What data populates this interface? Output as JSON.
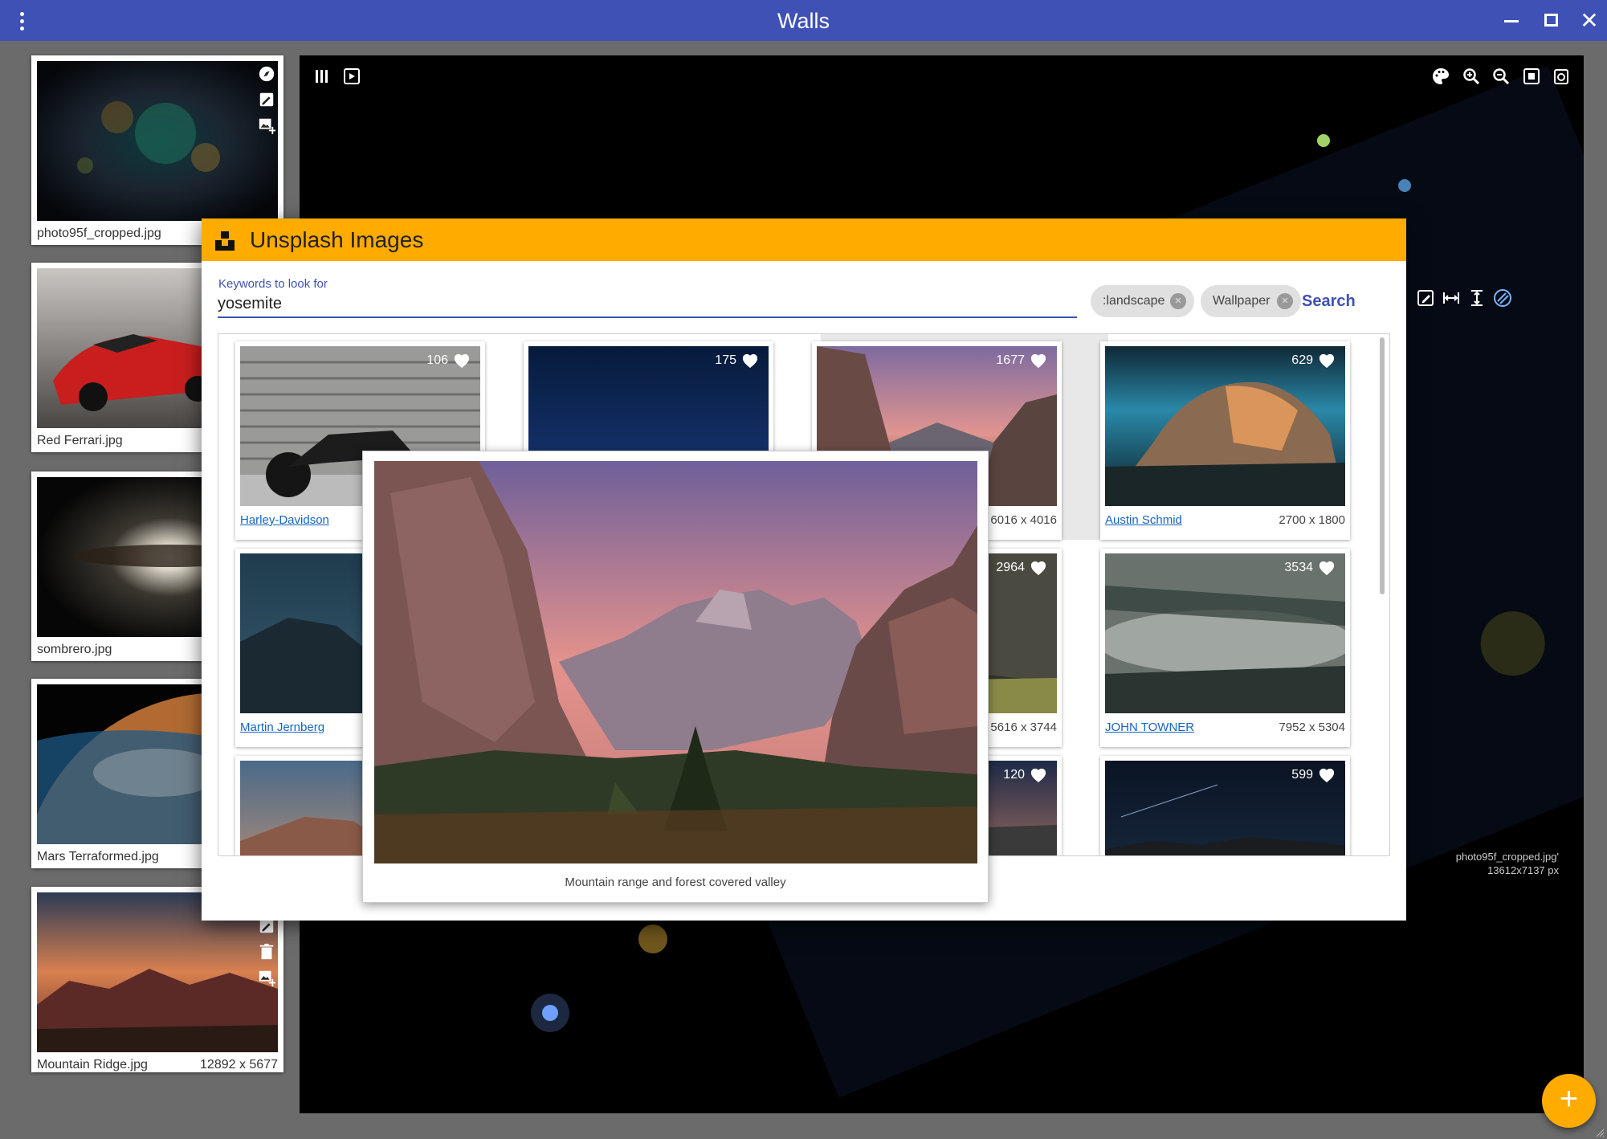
{
  "window": {
    "title": "Walls"
  },
  "gallery": [
    {
      "name": "photo95f_cropped.jpg",
      "size": ""
    },
    {
      "name": "Red Ferrari.jpg",
      "size": ""
    },
    {
      "name": "sombrero.jpg",
      "size": ""
    },
    {
      "name": "Mars Terraformed.jpg",
      "size": ""
    },
    {
      "name": "Mountain Ridge.jpg",
      "size": "12892 x 5677"
    }
  ],
  "viewer": {
    "overlay_filename": "photo95f_cropped.jpg'",
    "overlay_size": "13612x7137 px"
  },
  "dialog": {
    "title": "Unsplash Images",
    "keyword_label": "Keywords to look for",
    "keyword_value": "yosemite",
    "chips": [
      ":landscape",
      "Wallpaper"
    ],
    "search_label": "Search",
    "results": [
      {
        "likes": "106",
        "author": "Harley-Davidson",
        "dims": ""
      },
      {
        "likes": "175",
        "author": "",
        "dims": ""
      },
      {
        "likes": "1677",
        "author": "",
        "dims": "6016 x 4016"
      },
      {
        "likes": "629",
        "author": "Austin Schmid",
        "dims": "2700 x 1800"
      },
      {
        "likes": "",
        "author": "Martin Jernberg",
        "dims": ""
      },
      {
        "likes": "",
        "author": "",
        "dims": ""
      },
      {
        "likes": "2964",
        "author": "",
        "dims": "5616 x 3744"
      },
      {
        "likes": "3534",
        "author": "JOHN TOWNER",
        "dims": "7952 x 5304"
      },
      {
        "likes": "",
        "author": "",
        "dims": ""
      },
      {
        "likes": "",
        "author": "",
        "dims": ""
      },
      {
        "likes": "120",
        "author": "",
        "dims": ""
      },
      {
        "likes": "599",
        "author": "",
        "dims": ""
      }
    ],
    "preview_caption": "Mountain range and forest covered valley"
  },
  "fab": {
    "label": "+"
  },
  "colors": {
    "titlebar": "#3f51b5",
    "accent": "#ffab00",
    "link": "#1565c0"
  },
  "icons": [
    "menu-dots-icon",
    "minimize-icon",
    "maximize-icon",
    "close-icon",
    "columns-icon",
    "slideshow-icon",
    "palette-icon",
    "zoom-in-icon",
    "zoom-out-icon",
    "fit-screen-icon",
    "rotate-icon",
    "compass-icon",
    "edit-icon",
    "add-image-icon",
    "trash-icon",
    "heart-icon",
    "fit-width-icon",
    "fit-height-icon",
    "unsplash-logo-icon"
  ]
}
